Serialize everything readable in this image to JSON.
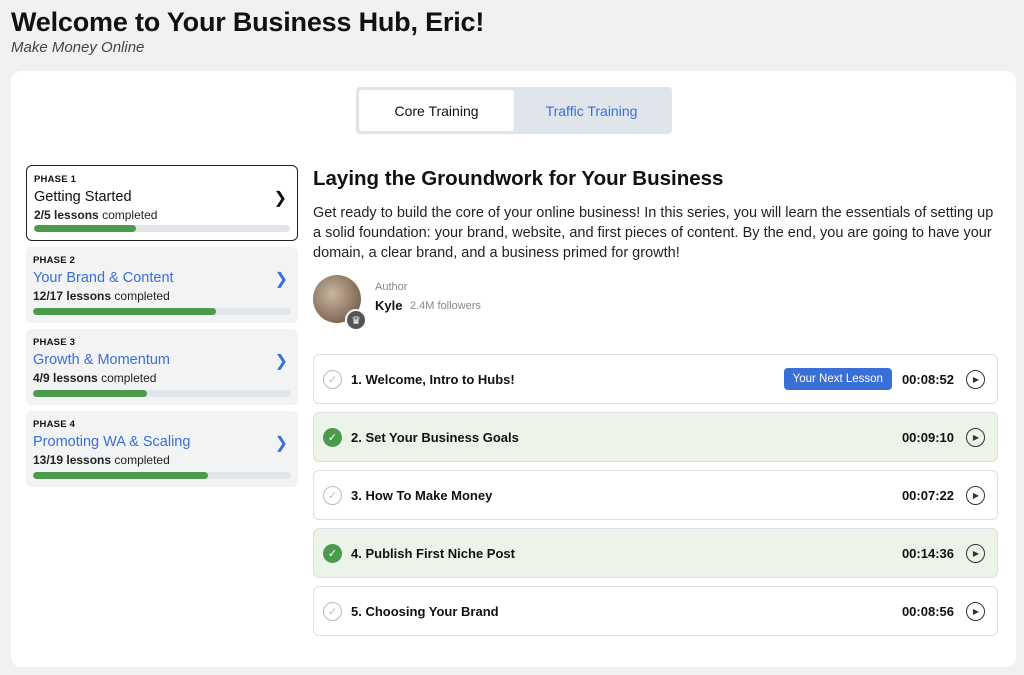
{
  "header": {
    "title": "Welcome to Your Business Hub, Eric!",
    "subtitle": "Make Money Online"
  },
  "tabs": [
    {
      "label": "Core Training",
      "active": true
    },
    {
      "label": "Traffic Training",
      "active": false
    }
  ],
  "phases": [
    {
      "num": "PHASE 1",
      "title": "Getting Started",
      "count": "2/5 lessons",
      "suffix": "completed",
      "progress": 0.4,
      "active": true
    },
    {
      "num": "PHASE 2",
      "title": "Your Brand & Content",
      "count": "12/17 lessons",
      "suffix": "completed",
      "progress": 0.71,
      "active": false
    },
    {
      "num": "PHASE 3",
      "title": "Growth & Momentum",
      "count": "4/9 lessons",
      "suffix": "completed",
      "progress": 0.44,
      "active": false
    },
    {
      "num": "PHASE 4",
      "title": "Promoting WA & Scaling",
      "count": "13/19 lessons",
      "suffix": "completed",
      "progress": 0.68,
      "active": false
    }
  ],
  "main": {
    "title": "Laying the Groundwork for Your Business",
    "description": "Get ready to build the core of your online business! In this series, you will learn the essentials of setting up a solid foundation: your brand, website, and first pieces of content. By the end, you are going to have your domain, a clear brand, and a business primed for growth!",
    "author_label": "Author",
    "author_name": "Kyle",
    "author_followers": "2.4M followers"
  },
  "lessons": [
    {
      "title": "1. Welcome, Intro to Hubs!",
      "duration": "00:08:52",
      "done": false,
      "badge": "Your Next Lesson"
    },
    {
      "title": "2. Set Your Business Goals",
      "duration": "00:09:10",
      "done": true
    },
    {
      "title": "3. How To Make Money",
      "duration": "00:07:22",
      "done": false
    },
    {
      "title": "4. Publish First Niche Post",
      "duration": "00:14:36",
      "done": true
    },
    {
      "title": "5. Choosing Your Brand",
      "duration": "00:08:56",
      "done": false
    }
  ],
  "colors": {
    "accent": "#3b6fd8",
    "progress": "#4c9a4c",
    "done_row": "#ecf4ea"
  }
}
